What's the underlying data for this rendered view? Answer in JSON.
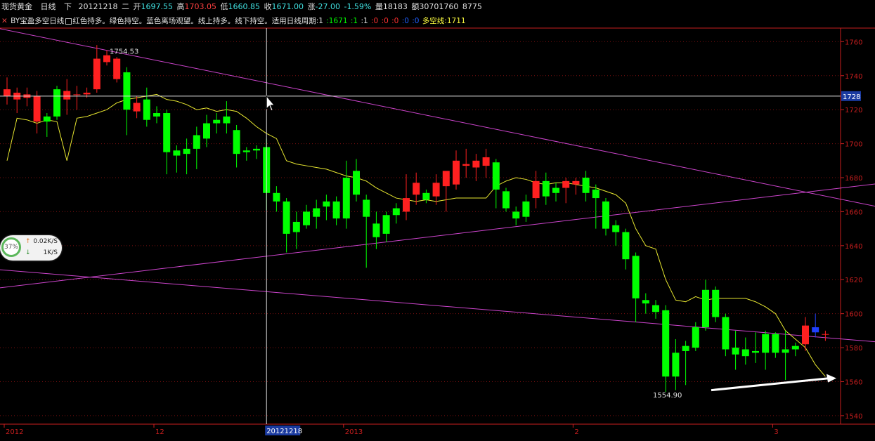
{
  "header": {
    "symbol": "现货黄金",
    "period": "日线",
    "direction": "下",
    "date": "20121218",
    "weekday": "二",
    "open_label": "开",
    "open": "1697.55",
    "high_label": "高",
    "high": "1703.05",
    "low_label": "低",
    "low": "1660.85",
    "close_label": "收",
    "close": "1671.00",
    "change_label": "涨",
    "change": "-27.00",
    "change_pct": "-1.59%",
    "volume_label": "量",
    "volume": "18183",
    "amount_label": "额",
    "amount": "30701760",
    "extra": "8775"
  },
  "indicator": {
    "name": "BY宝盈多空日线",
    "desc": "红色持多。绿色持空。蓝色离场观望。线上持多。线下持空。适用日线周期:1",
    "v1": ":1671",
    "v2": ":1",
    "v3": ":1",
    "v4": ":0",
    "v5": ":0",
    "v6": ":0",
    "v7": ":0",
    "v8": ":0",
    "line_label": "多空线:1711"
  },
  "speed_widget": {
    "percent": "37%",
    "up": "0.02K/S",
    "down": "1K/S"
  },
  "colors": {
    "up": "#ff2020",
    "down": "#00ff00",
    "neutral": "#2040ff",
    "line": "#e8e830",
    "trend": "#cc44cc",
    "grid": "#7a1010",
    "axis": "#c81e1e"
  },
  "chart_data": {
    "type": "candlestick",
    "ylim": [
      1535,
      1768
    ],
    "y_ticks": [
      "1760",
      "1740",
      "1720",
      "1700",
      "1680",
      "1660",
      "1640",
      "1620",
      "1600",
      "1580",
      "1560",
      "1540"
    ],
    "x_labels": [
      {
        "text": "2012",
        "index": 0
      },
      {
        "text": "12",
        "index": 15
      },
      {
        "text": "2013",
        "index": 34
      },
      {
        "text": "2",
        "index": 57
      },
      {
        "text": "3",
        "index": 77
      }
    ],
    "crosshair": {
      "index": 26,
      "price": 1728,
      "price_label": "1728",
      "date_label": "20121218"
    },
    "annotations": [
      {
        "text": "1754.53",
        "index": 10,
        "price": 1754.53
      },
      {
        "text": "1554.90",
        "index": 70,
        "price": 1554.9
      }
    ],
    "candles": [
      {
        "o": 1732,
        "h": 1739,
        "l": 1723,
        "c": 1728,
        "col": "up"
      },
      {
        "o": 1726,
        "h": 1733,
        "l": 1718,
        "c": 1730,
        "col": "up"
      },
      {
        "o": 1729,
        "h": 1733,
        "l": 1722,
        "c": 1727,
        "col": "up"
      },
      {
        "o": 1728,
        "h": 1731,
        "l": 1706,
        "c": 1713,
        "col": "up"
      },
      {
        "o": 1716,
        "h": 1718,
        "l": 1704,
        "c": 1713,
        "col": "down"
      },
      {
        "o": 1716,
        "h": 1734,
        "l": 1714,
        "c": 1732,
        "col": "down"
      },
      {
        "o": 1731,
        "h": 1738,
        "l": 1717,
        "c": 1726,
        "col": "up"
      },
      {
        "o": 1729,
        "h": 1734,
        "l": 1720,
        "c": 1729,
        "col": "up"
      },
      {
        "o": 1729,
        "h": 1733,
        "l": 1727,
        "c": 1730,
        "col": "up"
      },
      {
        "o": 1732,
        "h": 1758,
        "l": 1730,
        "c": 1750,
        "col": "up"
      },
      {
        "o": 1752,
        "h": 1755,
        "l": 1746,
        "c": 1748,
        "col": "up"
      },
      {
        "o": 1750,
        "h": 1751,
        "l": 1736,
        "c": 1738,
        "col": "up"
      },
      {
        "o": 1742,
        "h": 1745,
        "l": 1705,
        "c": 1720,
        "col": "down"
      },
      {
        "o": 1724,
        "h": 1728,
        "l": 1715,
        "c": 1719,
        "col": "up"
      },
      {
        "o": 1726,
        "h": 1733,
        "l": 1710,
        "c": 1714,
        "col": "down"
      },
      {
        "o": 1716,
        "h": 1722,
        "l": 1712,
        "c": 1718,
        "col": "down"
      },
      {
        "o": 1718,
        "h": 1720,
        "l": 1682,
        "c": 1695,
        "col": "down"
      },
      {
        "o": 1696,
        "h": 1699,
        "l": 1683,
        "c": 1693,
        "col": "down"
      },
      {
        "o": 1694,
        "h": 1703,
        "l": 1682,
        "c": 1697,
        "col": "down"
      },
      {
        "o": 1697,
        "h": 1710,
        "l": 1685,
        "c": 1705,
        "col": "down"
      },
      {
        "o": 1703,
        "h": 1717,
        "l": 1698,
        "c": 1712,
        "col": "down"
      },
      {
        "o": 1712,
        "h": 1718,
        "l": 1706,
        "c": 1714,
        "col": "down"
      },
      {
        "o": 1716,
        "h": 1725,
        "l": 1706,
        "c": 1712,
        "col": "down"
      },
      {
        "o": 1708,
        "h": 1711,
        "l": 1686,
        "c": 1694,
        "col": "down"
      },
      {
        "o": 1695,
        "h": 1698,
        "l": 1690,
        "c": 1696,
        "col": "down"
      },
      {
        "o": 1696,
        "h": 1699,
        "l": 1691,
        "c": 1697,
        "col": "down"
      },
      {
        "o": 1698,
        "h": 1703,
        "l": 1661,
        "c": 1671,
        "col": "down"
      },
      {
        "o": 1671,
        "h": 1675,
        "l": 1660,
        "c": 1666,
        "col": "down"
      },
      {
        "o": 1666,
        "h": 1668,
        "l": 1636,
        "c": 1647,
        "col": "down"
      },
      {
        "o": 1648,
        "h": 1660,
        "l": 1638,
        "c": 1654,
        "col": "down"
      },
      {
        "o": 1652,
        "h": 1664,
        "l": 1650,
        "c": 1660,
        "col": "down"
      },
      {
        "o": 1657,
        "h": 1667,
        "l": 1650,
        "c": 1662,
        "col": "down"
      },
      {
        "o": 1663,
        "h": 1670,
        "l": 1655,
        "c": 1666,
        "col": "down"
      },
      {
        "o": 1666,
        "h": 1669,
        "l": 1652,
        "c": 1656,
        "col": "down"
      },
      {
        "o": 1656,
        "h": 1690,
        "l": 1650,
        "c": 1680,
        "col": "down"
      },
      {
        "o": 1684,
        "h": 1691,
        "l": 1666,
        "c": 1670,
        "col": "down"
      },
      {
        "o": 1667,
        "h": 1670,
        "l": 1627,
        "c": 1657,
        "col": "down"
      },
      {
        "o": 1653,
        "h": 1660,
        "l": 1638,
        "c": 1645,
        "col": "down"
      },
      {
        "o": 1647,
        "h": 1660,
        "l": 1642,
        "c": 1658,
        "col": "down"
      },
      {
        "o": 1658,
        "h": 1665,
        "l": 1653,
        "c": 1662,
        "col": "down"
      },
      {
        "o": 1660,
        "h": 1682,
        "l": 1655,
        "c": 1668,
        "col": "up"
      },
      {
        "o": 1670,
        "h": 1683,
        "l": 1664,
        "c": 1677,
        "col": "up"
      },
      {
        "o": 1667,
        "h": 1673,
        "l": 1665,
        "c": 1671,
        "col": "down"
      },
      {
        "o": 1669,
        "h": 1682,
        "l": 1664,
        "c": 1677,
        "col": "up"
      },
      {
        "o": 1675,
        "h": 1682,
        "l": 1660,
        "c": 1684,
        "col": "up"
      },
      {
        "o": 1676,
        "h": 1696,
        "l": 1673,
        "c": 1690,
        "col": "up"
      },
      {
        "o": 1688,
        "h": 1697,
        "l": 1680,
        "c": 1687,
        "col": "up"
      },
      {
        "o": 1686,
        "h": 1694,
        "l": 1678,
        "c": 1690,
        "col": "up"
      },
      {
        "o": 1692,
        "h": 1697,
        "l": 1680,
        "c": 1687,
        "col": "up"
      },
      {
        "o": 1689,
        "h": 1691,
        "l": 1662,
        "c": 1673,
        "col": "down"
      },
      {
        "o": 1672,
        "h": 1674,
        "l": 1660,
        "c": 1662,
        "col": "down"
      },
      {
        "o": 1660,
        "h": 1663,
        "l": 1652,
        "c": 1656,
        "col": "down"
      },
      {
        "o": 1657,
        "h": 1670,
        "l": 1654,
        "c": 1666,
        "col": "down"
      },
      {
        "o": 1668,
        "h": 1684,
        "l": 1662,
        "c": 1678,
        "col": "up"
      },
      {
        "o": 1678,
        "h": 1683,
        "l": 1664,
        "c": 1669,
        "col": "down"
      },
      {
        "o": 1671,
        "h": 1677,
        "l": 1666,
        "c": 1674,
        "col": "down"
      },
      {
        "o": 1674,
        "h": 1680,
        "l": 1665,
        "c": 1678,
        "col": "up"
      },
      {
        "o": 1678,
        "h": 1680,
        "l": 1670,
        "c": 1676,
        "col": "up"
      },
      {
        "o": 1680,
        "h": 1684,
        "l": 1666,
        "c": 1671,
        "col": "down"
      },
      {
        "o": 1673,
        "h": 1676,
        "l": 1650,
        "c": 1668,
        "col": "down"
      },
      {
        "o": 1666,
        "h": 1668,
        "l": 1646,
        "c": 1650,
        "col": "down"
      },
      {
        "o": 1652,
        "h": 1655,
        "l": 1640,
        "c": 1648,
        "col": "down"
      },
      {
        "o": 1648,
        "h": 1650,
        "l": 1626,
        "c": 1632,
        "col": "down"
      },
      {
        "o": 1634,
        "h": 1636,
        "l": 1595,
        "c": 1609,
        "col": "down"
      },
      {
        "o": 1608,
        "h": 1612,
        "l": 1600,
        "c": 1606,
        "col": "down"
      },
      {
        "o": 1605,
        "h": 1608,
        "l": 1597,
        "c": 1601,
        "col": "down"
      },
      {
        "o": 1602,
        "h": 1605,
        "l": 1554,
        "c": 1563,
        "col": "down"
      },
      {
        "o": 1563,
        "h": 1585,
        "l": 1555,
        "c": 1577,
        "col": "down"
      },
      {
        "o": 1578,
        "h": 1584,
        "l": 1558,
        "c": 1581,
        "col": "down"
      },
      {
        "o": 1580,
        "h": 1595,
        "l": 1578,
        "c": 1592,
        "col": "down"
      },
      {
        "o": 1592,
        "h": 1620,
        "l": 1590,
        "c": 1614,
        "col": "down"
      },
      {
        "o": 1614,
        "h": 1616,
        "l": 1595,
        "c": 1598,
        "col": "down"
      },
      {
        "o": 1598,
        "h": 1600,
        "l": 1575,
        "c": 1579,
        "col": "down"
      },
      {
        "o": 1580,
        "h": 1590,
        "l": 1567,
        "c": 1576,
        "col": "down"
      },
      {
        "o": 1575,
        "h": 1586,
        "l": 1570,
        "c": 1579,
        "col": "down"
      },
      {
        "o": 1577,
        "h": 1589,
        "l": 1571,
        "c": 1578,
        "col": "down"
      },
      {
        "o": 1577,
        "h": 1590,
        "l": 1567,
        "c": 1588,
        "col": "down"
      },
      {
        "o": 1588,
        "h": 1589,
        "l": 1574,
        "c": 1577,
        "col": "down"
      },
      {
        "o": 1577,
        "h": 1590,
        "l": 1561,
        "c": 1579,
        "col": "down"
      },
      {
        "o": 1579,
        "h": 1583,
        "l": 1575,
        "c": 1581,
        "col": "down"
      },
      {
        "o": 1582,
        "h": 1598,
        "l": 1578,
        "c": 1593,
        "col": "up"
      },
      {
        "o": 1592,
        "h": 1600,
        "l": 1586,
        "c": 1589,
        "col": "neutral"
      },
      {
        "o": 1588,
        "h": 1590,
        "l": 1584,
        "c": 1588,
        "col": "up"
      }
    ],
    "line_series": {
      "name": "多空线",
      "values": [
        1690,
        1715,
        1714,
        1712,
        1714,
        1713,
        1690,
        1715,
        1716,
        1718,
        1720,
        1724,
        1726,
        1727,
        1728,
        1729,
        1726,
        1725,
        1723,
        1720,
        1721,
        1719,
        1720,
        1719,
        1715,
        1710,
        1706,
        1703,
        1690,
        1688,
        1687,
        1686,
        1685,
        1683,
        1681,
        1680,
        1678,
        1674,
        1671,
        1668,
        1667,
        1666,
        1667,
        1666,
        1667,
        1668,
        1668,
        1668,
        1668,
        1675,
        1678,
        1680,
        1679,
        1677,
        1676,
        1677,
        1677,
        1676,
        1675,
        1674,
        1672,
        1670,
        1665,
        1650,
        1640,
        1638,
        1620,
        1608,
        1607,
        1610,
        1608,
        1609,
        1609,
        1609,
        1609,
        1607,
        1604,
        1600,
        1590,
        1585,
        1580,
        1570,
        1563
      ]
    },
    "trendlines": [
      {
        "x1": -1,
        "y1": 1768,
        "x2": 88,
        "y2": 1662
      },
      {
        "x1": -1,
        "y1": 1615,
        "x2": 88,
        "y2": 1677
      },
      {
        "x1": -1,
        "y1": 1626,
        "x2": 88,
        "y2": 1583
      }
    ]
  }
}
